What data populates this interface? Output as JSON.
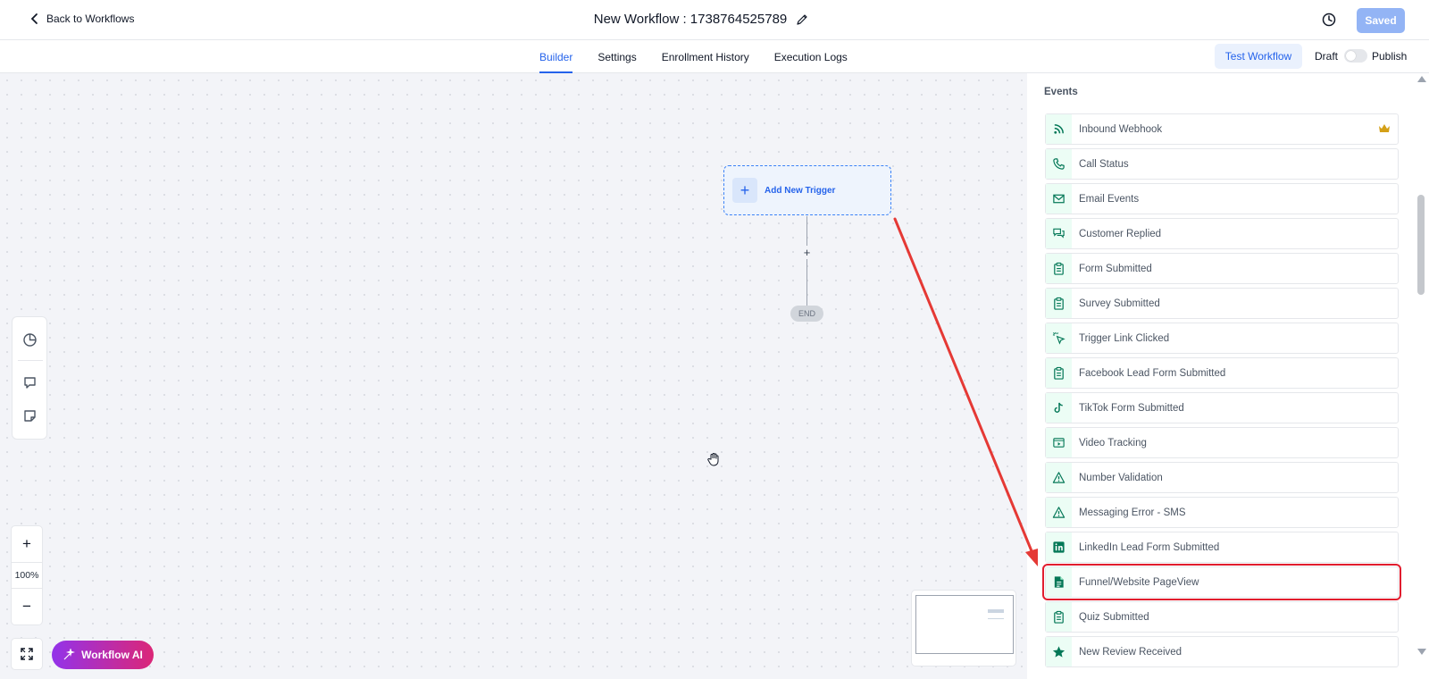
{
  "header": {
    "back_label": "Back to Workflows",
    "workflow_title": "New Workflow : 1738764525789",
    "saved_label": "Saved"
  },
  "tabs": [
    {
      "label": "Builder",
      "active": true
    },
    {
      "label": "Settings",
      "active": false
    },
    {
      "label": "Enrollment History",
      "active": false
    },
    {
      "label": "Execution Logs",
      "active": false
    }
  ],
  "actions": {
    "test_label": "Test Workflow",
    "draft_label": "Draft",
    "publish_label": "Publish",
    "publish_toggle_on": false
  },
  "canvas": {
    "trigger_label": "Add New Trigger",
    "end_label": "END",
    "zoom_level": "100%",
    "ai_label": "Workflow AI"
  },
  "panel": {
    "title": "Events",
    "items": [
      {
        "label": "Inbound Webhook",
        "icon": "rss-icon",
        "premium": true
      },
      {
        "label": "Call Status",
        "icon": "phone-icon"
      },
      {
        "label": "Email Events",
        "icon": "mail-icon"
      },
      {
        "label": "Customer Replied",
        "icon": "chat-icon"
      },
      {
        "label": "Form Submitted",
        "icon": "clipboard-icon"
      },
      {
        "label": "Survey Submitted",
        "icon": "clipboard-icon"
      },
      {
        "label": "Trigger Link Clicked",
        "icon": "cursor-click-icon"
      },
      {
        "label": "Facebook Lead Form Submitted",
        "icon": "clipboard-icon"
      },
      {
        "label": "TikTok Form Submitted",
        "icon": "tiktok-icon"
      },
      {
        "label": "Video Tracking",
        "icon": "video-icon"
      },
      {
        "label": "Number Validation",
        "icon": "warning-icon"
      },
      {
        "label": "Messaging Error - SMS",
        "icon": "warning-icon"
      },
      {
        "label": "LinkedIn Lead Form Submitted",
        "icon": "linkedin-icon"
      },
      {
        "label": "Funnel/Website PageView",
        "icon": "document-icon",
        "highlighted": true
      },
      {
        "label": "Quiz Submitted",
        "icon": "clipboard-icon"
      },
      {
        "label": "New Review Received",
        "icon": "star-icon"
      }
    ]
  },
  "colors": {
    "accent": "#2563eb",
    "icon_green": "#047857",
    "annotation_red": "#e11d2e"
  }
}
